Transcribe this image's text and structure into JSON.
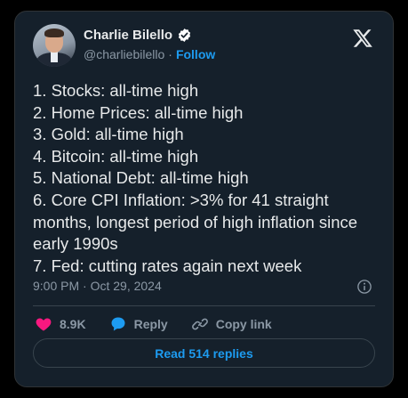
{
  "author": {
    "name": "Charlie Bilello",
    "handle": "@charliebilello",
    "separator": "·",
    "follow_label": "Follow"
  },
  "tweet": {
    "lines": [
      "1. Stocks: all-time high",
      "2. Home Prices: all-time high",
      "3. Gold: all-time high",
      "4. Bitcoin: all-time high",
      "5. National Debt: all-time high",
      "6. Core CPI Inflation: >3% for 41 straight months, longest period of high inflation since early 1990s",
      "7. Fed: cutting rates again next week"
    ],
    "timestamp": "9:00 PM · Oct 29, 2024"
  },
  "actions": {
    "like_count": "8.9K",
    "reply_label": "Reply",
    "copy_link_label": "Copy link",
    "read_replies_label": "Read 514 replies"
  },
  "icons": {
    "verified": "verified-badge-icon",
    "x_logo": "x-logo-icon",
    "info": "info-icon",
    "heart": "heart-icon",
    "reply": "reply-bubble-icon",
    "link": "link-icon"
  },
  "colors": {
    "background": "#000000",
    "card": "#15202b",
    "text": "#e7e9ea",
    "muted": "#8b98a5",
    "accent": "#1d9bf0",
    "like": "#f91880"
  }
}
